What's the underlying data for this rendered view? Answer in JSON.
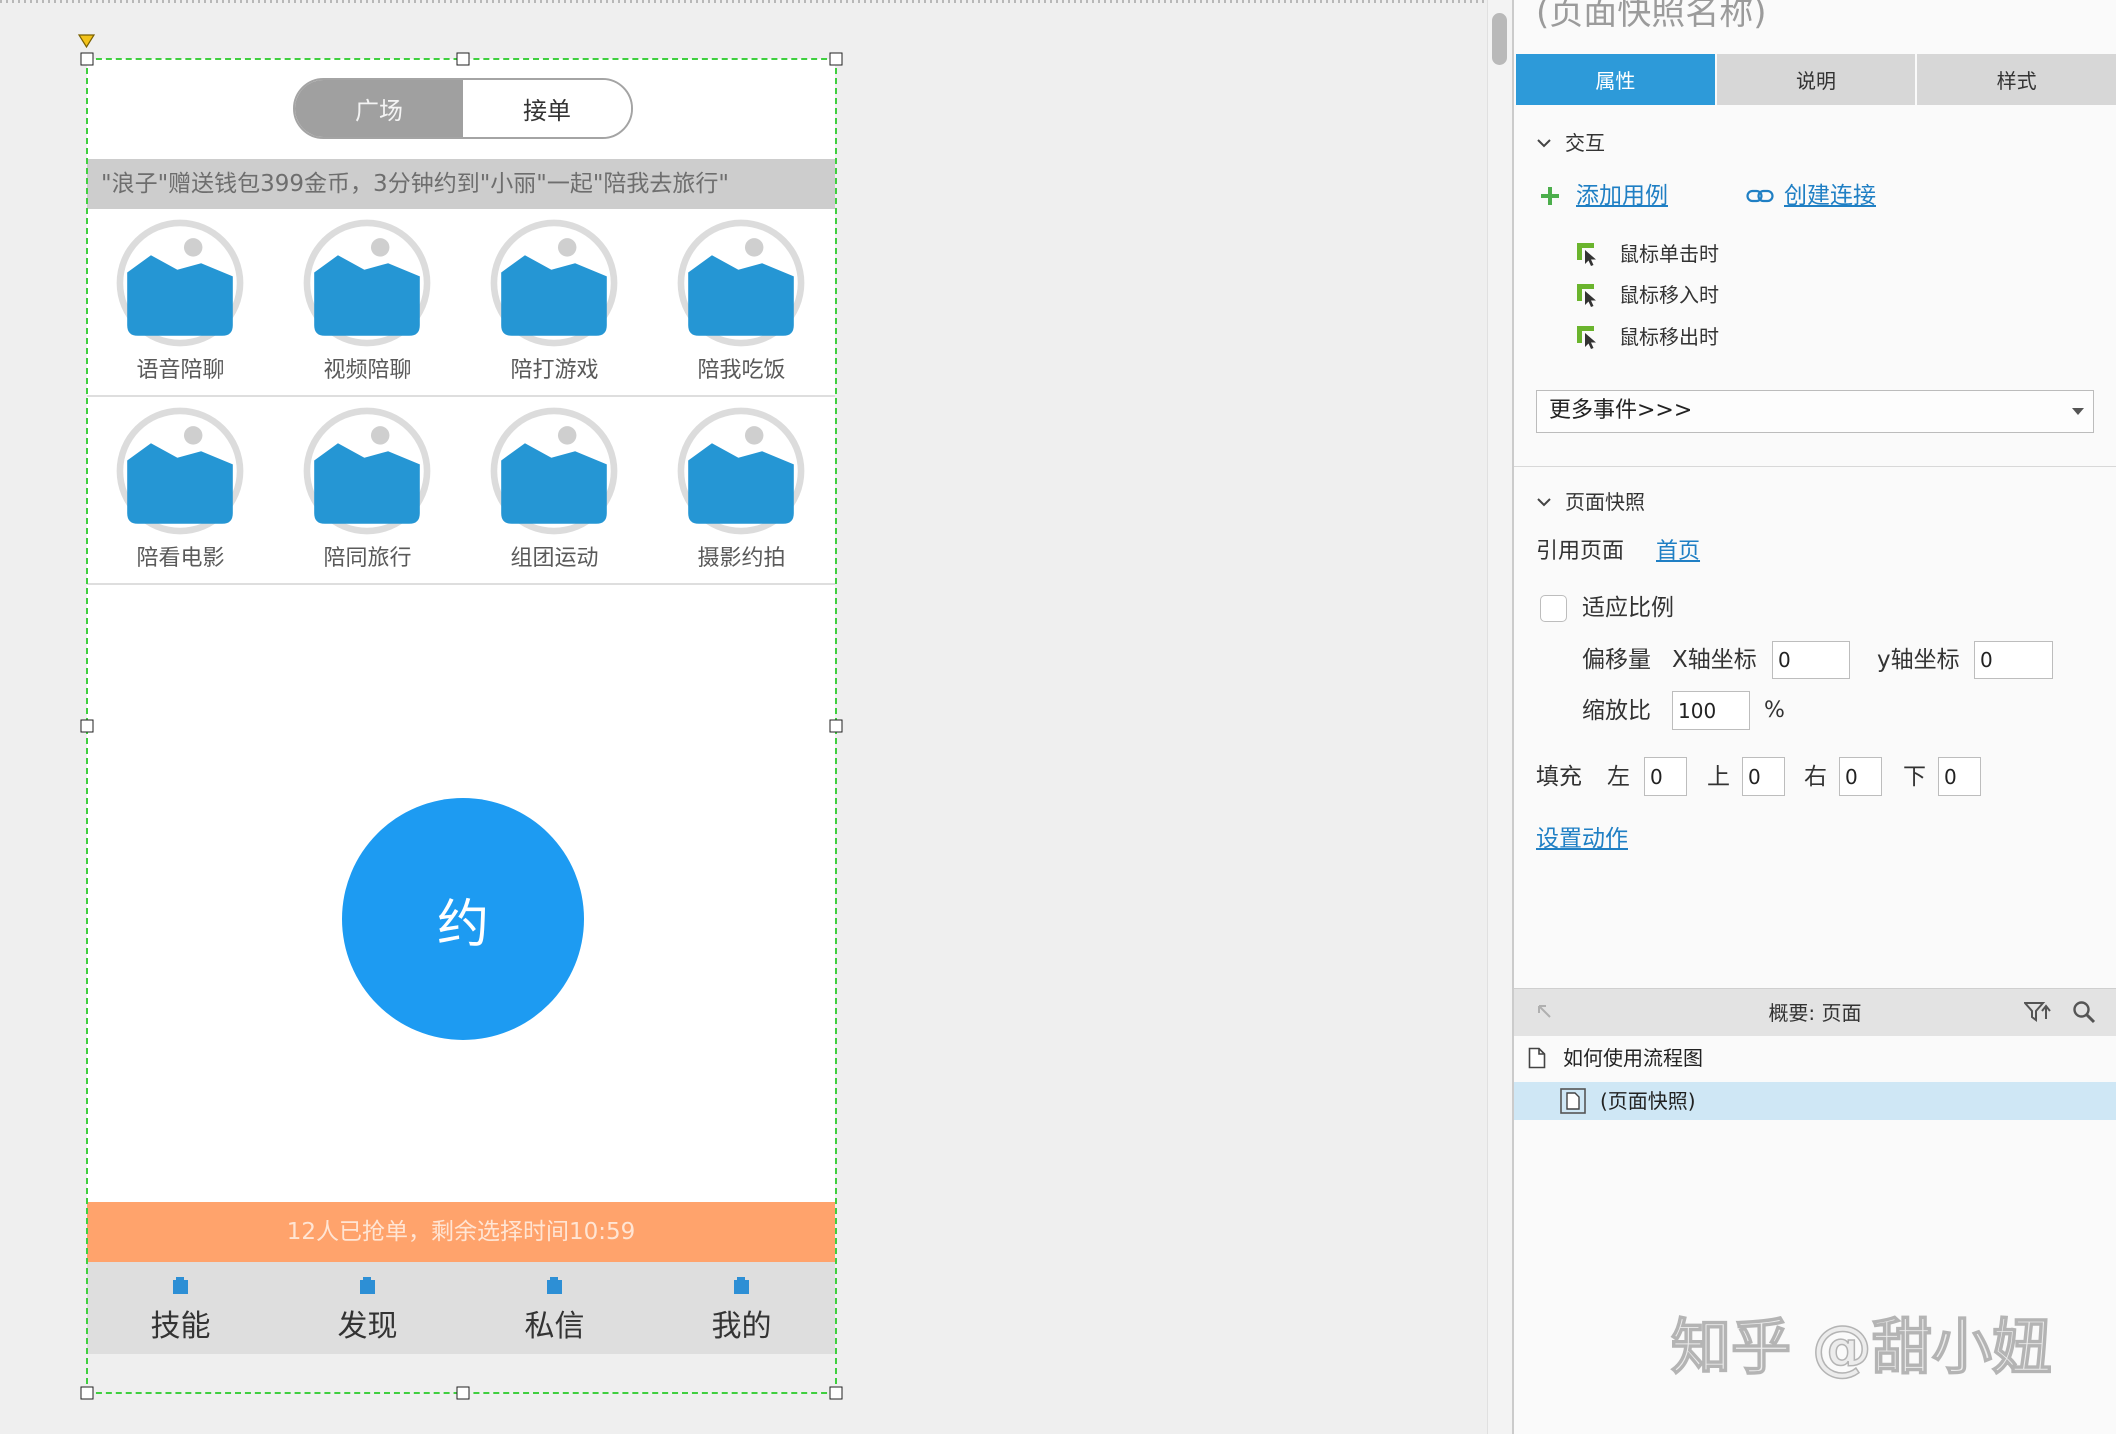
{
  "colors": {
    "accent_tab": "#2d9ad9",
    "primary_button": "#1d9bf2",
    "status_bar": "#ffa36c",
    "link": "#1f7fc4",
    "selection_frame": "#3fcf3f",
    "selected_row": "#cfe7f5"
  },
  "canvas": {
    "phone": {
      "segmented": [
        {
          "label": "广场",
          "active": true
        },
        {
          "label": "接单",
          "active": false
        }
      ],
      "marquee": "\"浪子\"赠送钱包399金币，3分钟约到\"小丽\"一起\"陪我去旅行\"",
      "services": [
        {
          "label": "语音陪聊",
          "icon": "image-placeholder-icon"
        },
        {
          "label": "视频陪聊",
          "icon": "image-placeholder-icon"
        },
        {
          "label": "陪打游戏",
          "icon": "image-placeholder-icon"
        },
        {
          "label": "陪我吃饭",
          "icon": "image-placeholder-icon"
        },
        {
          "label": "陪看电影",
          "icon": "image-placeholder-icon"
        },
        {
          "label": "陪同旅行",
          "icon": "image-placeholder-icon"
        },
        {
          "label": "组团运动",
          "icon": "image-placeholder-icon"
        },
        {
          "label": "摄影约拍",
          "icon": "image-placeholder-icon"
        }
      ],
      "main_button": "约",
      "status_text": "12人已抢单，剩余选择时间10:59",
      "tabbar": [
        {
          "label": "技能",
          "icon": "tab-icon"
        },
        {
          "label": "发现",
          "icon": "tab-icon"
        },
        {
          "label": "私信",
          "icon": "tab-icon"
        },
        {
          "label": "我的",
          "icon": "tab-icon"
        }
      ]
    }
  },
  "inspector": {
    "title": "(页面快照名称)",
    "tabs": [
      {
        "label": "属性",
        "active": true
      },
      {
        "label": "说明",
        "active": false
      },
      {
        "label": "样式",
        "active": false
      }
    ],
    "interaction": {
      "section_label": "交互",
      "add_case": "添加用例",
      "create_link": "创建连接",
      "events": [
        "鼠标单击时",
        "鼠标移入时",
        "鼠标移出时"
      ],
      "more_events": "更多事件>>>"
    },
    "snapshot": {
      "section_label": "页面快照",
      "ref_label": "引用页面",
      "ref_page": "首页",
      "fit_label": "适应比例",
      "fit_checked": false,
      "offset_label": "偏移量",
      "x_label": "X轴坐标",
      "x_value": "0",
      "y_label": "y轴坐标",
      "y_value": "0",
      "scale_label": "缩放比",
      "scale_value": "100",
      "scale_unit": "%",
      "padding_label": "填充",
      "padding": [
        {
          "label": "左",
          "value": "0"
        },
        {
          "label": "上",
          "value": "0"
        },
        {
          "label": "右",
          "value": "0"
        },
        {
          "label": "下",
          "value": "0"
        }
      ],
      "set_action": "设置动作"
    },
    "outline": {
      "title": "概要: 页面",
      "items": [
        {
          "label": "如何使用流程图",
          "selected": false
        },
        {
          "label": "(页面快照)",
          "selected": true
        }
      ]
    }
  },
  "watermark": "知乎 @甜小妞"
}
